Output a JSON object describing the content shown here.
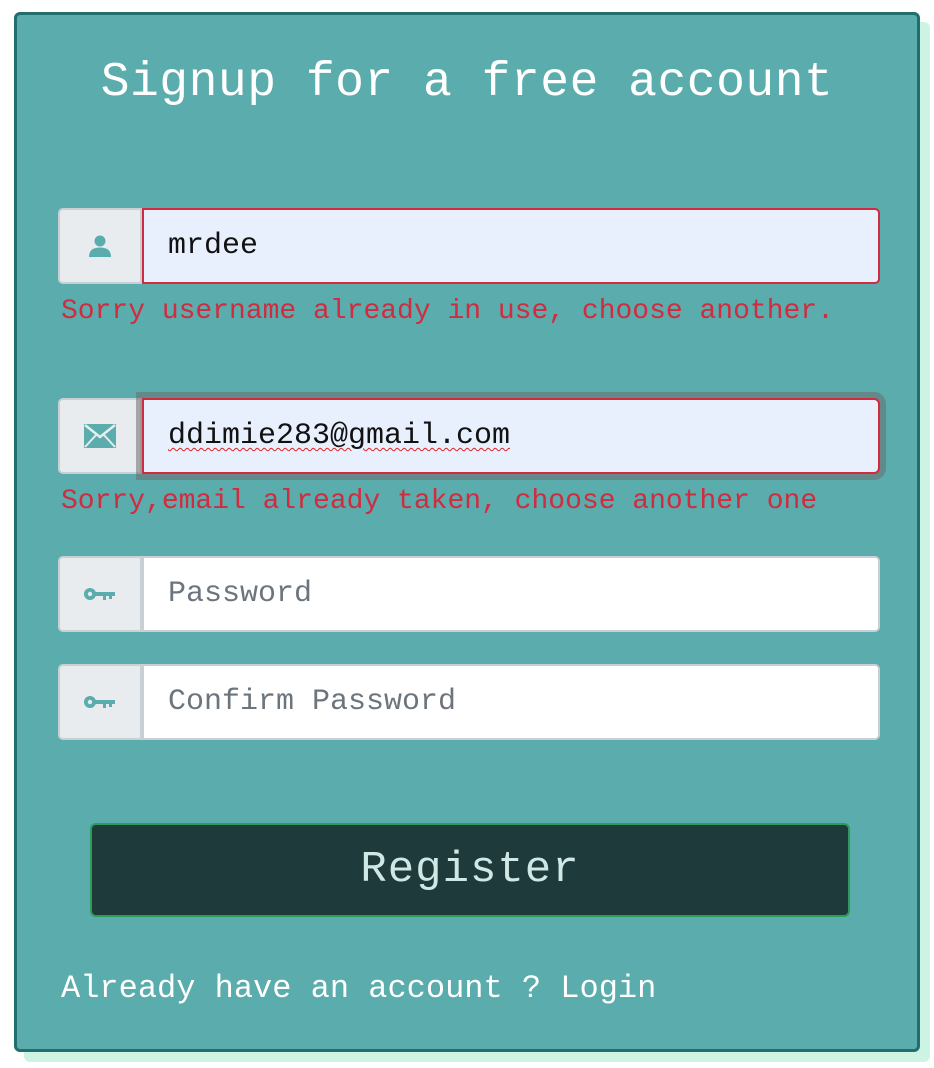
{
  "form": {
    "title": "Signup for a free account",
    "username": {
      "icon": "user-icon",
      "value": "mrdee",
      "error": "Sorry username already in use, choose another."
    },
    "email": {
      "icon": "envelope-icon",
      "value": "ddimie283@gmail.com",
      "error": "Sorry,email already taken, choose another one"
    },
    "password": {
      "icon": "key-icon",
      "value": "",
      "placeholder": "Password"
    },
    "confirm_password": {
      "icon": "key-icon",
      "value": "",
      "placeholder": "Confirm Password"
    },
    "register_label": "Register",
    "footer_text": "Already have an account ?",
    "login_label": "Login"
  },
  "colors": {
    "card_background": "#5aacad",
    "card_border": "#226e6e",
    "error": "#d12b3f",
    "button_background": "#1e3a3a",
    "button_text": "#cfe7e5",
    "icon": "#5aacad"
  }
}
